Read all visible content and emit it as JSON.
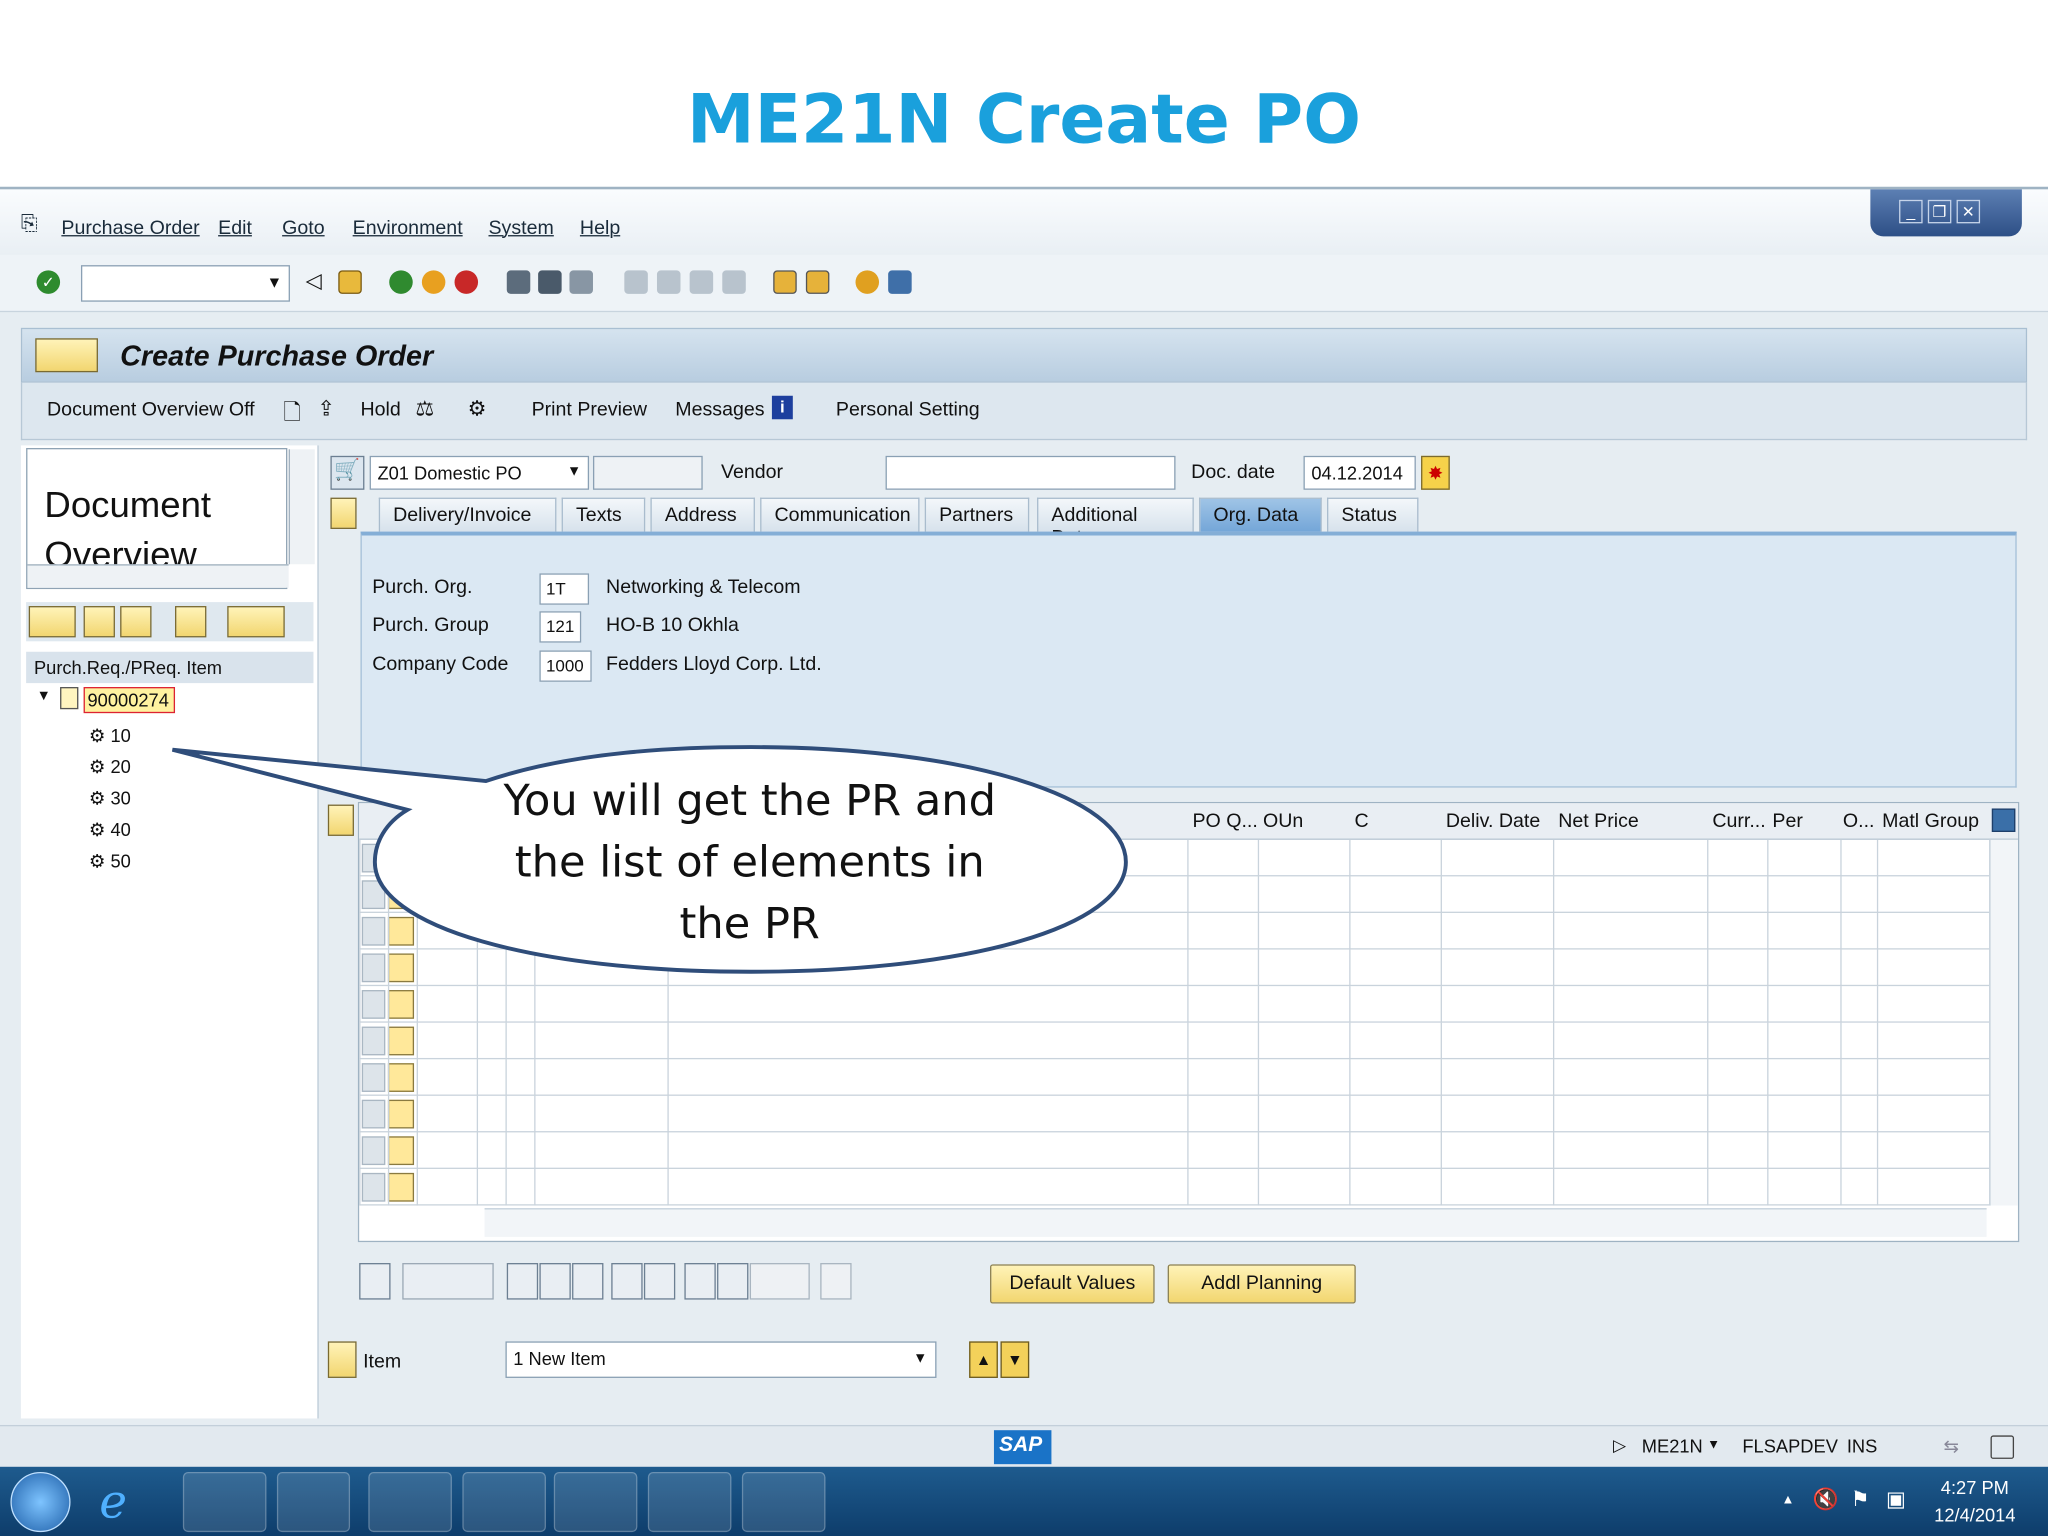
{
  "slide": {
    "title": "ME21N Create PO"
  },
  "menu": [
    "Purchase Order",
    "Edit",
    "Goto",
    "Environment",
    "System",
    "Help"
  ],
  "screen_title": "Create Purchase Order",
  "app_toolbar": {
    "document_overview_off": "Document Overview Off",
    "hold": "Hold",
    "print_preview": "Print Preview",
    "messages": "Messages",
    "personal_setting": "Personal Setting"
  },
  "left_pane": {
    "doc_overview_line1": "Document",
    "doc_overview_line2": "Overview",
    "tree_header": "Purch.Req./PReq. Item",
    "root": "90000274",
    "items": [
      "10",
      "20",
      "30",
      "40",
      "50"
    ]
  },
  "header": {
    "doc_type": "Z01 Domestic PO",
    "vendor_label": "Vendor",
    "doc_date_label": "Doc. date",
    "doc_date": "04.12.2014"
  },
  "tabs": [
    "Delivery/Invoice",
    "Texts",
    "Address",
    "Communication",
    "Partners",
    "Additional Data",
    "Org. Data",
    "Status"
  ],
  "org_data": {
    "purch_org_label": "Purch. Org.",
    "purch_org": "1T",
    "purch_org_desc": "Networking & Telecom",
    "purch_group_label": "Purch. Group",
    "purch_group": "121",
    "purch_group_desc": "HO-B 10 Okhla",
    "company_code_label": "Company Code",
    "company_code": "1000",
    "company_code_desc": "Fedders Lloyd Corp. Ltd."
  },
  "grid_columns": [
    "PO Q...",
    "OUn",
    "C",
    "Deliv. Date",
    "Net Price",
    "Curr...",
    "Per",
    "O...",
    "Matl Group"
  ],
  "buttons": {
    "default_values": "Default Values",
    "addl_planning": "Addl Planning"
  },
  "item_row": {
    "label": "Item",
    "value": "1 New Item"
  },
  "callout": {
    "line1": "You will get the PR and",
    "line2": "the list of elements in",
    "line3": "the PR"
  },
  "status": {
    "logo": "SAP",
    "tcode": "ME21N",
    "system": "FLSAPDEV",
    "mode": "INS"
  },
  "clock": {
    "time": "4:27 PM",
    "date": "12/4/2014"
  }
}
